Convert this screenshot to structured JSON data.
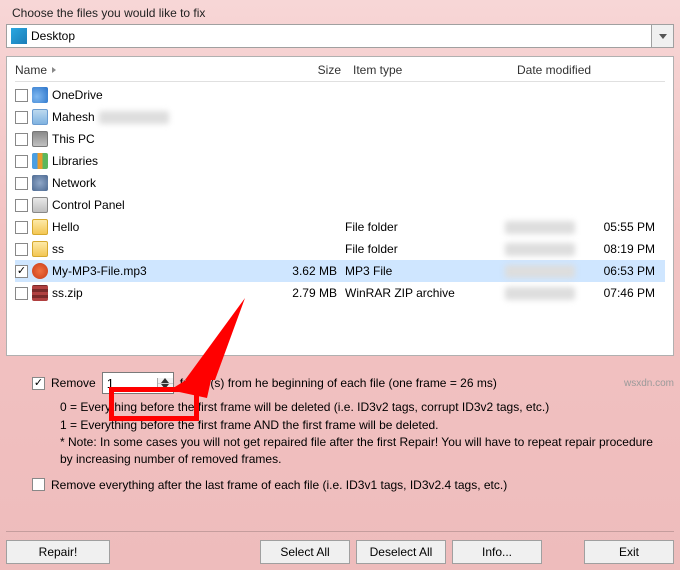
{
  "prompt": "Choose the files you would like to fix",
  "location": {
    "label": "Desktop"
  },
  "columns": {
    "name": "Name",
    "size": "Size",
    "type": "Item type",
    "date": "Date modified"
  },
  "rows": [
    {
      "checked": false,
      "icon": "cloud",
      "name": "OneDrive",
      "size": "",
      "type": "",
      "date": "",
      "time": ""
    },
    {
      "checked": false,
      "icon": "user",
      "name": "Mahesh",
      "size": "",
      "type": "",
      "date": "",
      "time": "",
      "name_blur": true
    },
    {
      "checked": false,
      "icon": "pc",
      "name": "This PC",
      "size": "",
      "type": "",
      "date": "",
      "time": ""
    },
    {
      "checked": false,
      "icon": "lib",
      "name": "Libraries",
      "size": "",
      "type": "",
      "date": "",
      "time": ""
    },
    {
      "checked": false,
      "icon": "net",
      "name": "Network",
      "size": "",
      "type": "",
      "date": "",
      "time": ""
    },
    {
      "checked": false,
      "icon": "cpl",
      "name": "Control Panel",
      "size": "",
      "type": "",
      "date": "",
      "time": ""
    },
    {
      "checked": false,
      "icon": "folder",
      "name": "Hello",
      "size": "",
      "type": "File folder",
      "date": "blur",
      "time": "05:55 PM"
    },
    {
      "checked": false,
      "icon": "folder",
      "name": "ss",
      "size": "",
      "type": "File folder",
      "date": "blur",
      "time": "08:19 PM"
    },
    {
      "checked": true,
      "icon": "mp3",
      "name": "My-MP3-File.mp3",
      "size": "3.62 MB",
      "type": "MP3 File",
      "date": "blur",
      "time": "06:53 PM",
      "selected": true
    },
    {
      "checked": false,
      "icon": "zip",
      "name": "ss.zip",
      "size": "2.79 MB",
      "type": "WinRAR ZIP archive",
      "date": "blur",
      "time": "07:46 PM"
    }
  ],
  "option_remove_frames": {
    "checked": true,
    "prefix": "Remove",
    "value": "1",
    "suffix": "frame(s) from he beginning of each file (one frame = 26 ms)",
    "sub0": "0 = Everything before the first frame will be deleted (i.e. ID3v2 tags, corrupt ID3v2 tags, etc.)",
    "sub1": "1 = Everything before the first frame AND the first frame will be deleted.",
    "note": "* Note: In some cases you will not get repaired file after the first Repair! You will have to repeat repair procedure by increasing number of removed frames."
  },
  "option_remove_after": {
    "checked": false,
    "label": "Remove everything after the last frame of each file (i.e. ID3v1 tags, ID3v2.4 tags, etc.)"
  },
  "buttons": {
    "repair": "Repair!",
    "select_all": "Select All",
    "deselect_all": "Deselect All",
    "info": "Info...",
    "exit": "Exit"
  },
  "watermark": "wsxdn.com"
}
